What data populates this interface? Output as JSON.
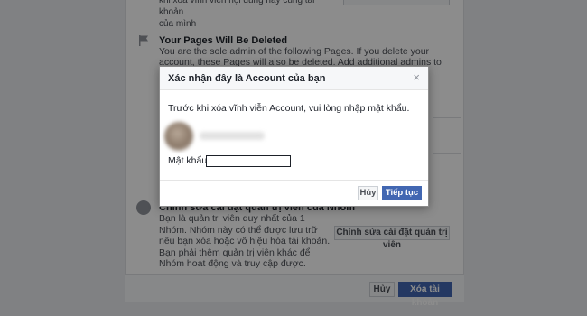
{
  "background": {
    "top_text": "khi xóa vĩnh viễn nội dung này cùng tài khoản\ncủa mình",
    "pages_section": {
      "title": "Your Pages Will Be Deleted",
      "text": "You are the sole admin of the following Pages. If you delete your account, these Pages will also be deleted. Add additional admins to keep these Pages"
    },
    "group_section": {
      "title": "Chỉnh sửa cài đặt quản trị viên của Nhóm",
      "text": "Bạn là quản trị viên duy nhất của 1 Nhóm. Nhóm này có thể được lưu trữ nếu bạn xóa hoặc vô hiệu hóa tài khoản. Bạn phải thêm quản trị viên khác để Nhóm hoạt động và truy cập được.",
      "button": "Chỉnh sửa cài đặt quản trị viên"
    },
    "footer": {
      "cancel": "Hủy",
      "delete": "Xóa tài khoản"
    }
  },
  "dialog": {
    "title": "Xác nhận đây là Account của bạn",
    "close": "×",
    "instruction": "Trước khi xóa vĩnh viễn Account, vui lòng nhập mật khẩu.",
    "password_label": "Mật khẩu:",
    "password_value": "",
    "cancel": "Hủy",
    "continue": "Tiếp tục"
  },
  "colors": {
    "accent": "#4267b2",
    "overlay": "#7f7f7f"
  }
}
